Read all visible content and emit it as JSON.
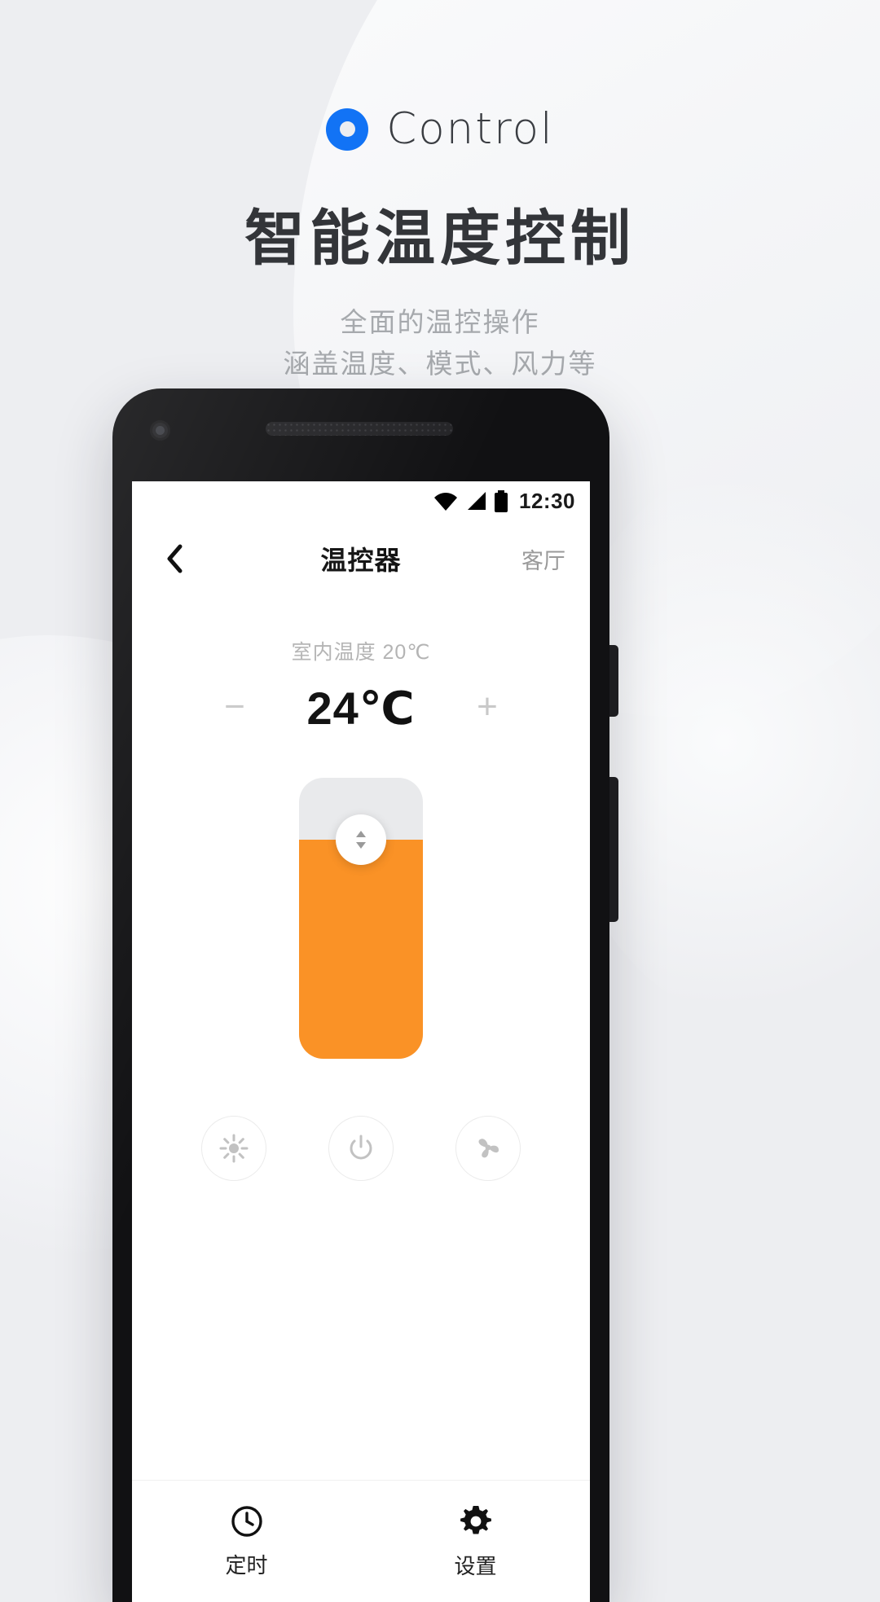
{
  "brand": {
    "name": "Control",
    "mark_icon": "ring-logo-icon",
    "accent": "#1273f5"
  },
  "hero": {
    "headline": "智能温度控制",
    "subtitle_line1": "全面的温控操作",
    "subtitle_line2": "涵盖温度、模式、风力等"
  },
  "phone": {
    "statusbar": {
      "wifi_icon": "wifi-icon",
      "signal_icon": "cellular-signal-icon",
      "battery_icon": "battery-full-icon",
      "clock": "12:30"
    },
    "appbar": {
      "back_icon": "chevron-left-icon",
      "title": "温控器",
      "room": "客厅"
    },
    "thermostat": {
      "room_temperature": "室内温度 20℃",
      "decrease_label": "−",
      "setpoint": "24℃",
      "increase_label": "+",
      "slider": {
        "fill_percent": 78,
        "fill_color": "#fa9226",
        "track_color": "#e9eaec",
        "knob_icon": "updown-arrows-icon"
      },
      "controls": [
        {
          "name": "mode-button",
          "icon": "sun-mode-icon"
        },
        {
          "name": "power-button",
          "icon": "power-icon"
        },
        {
          "name": "fan-button",
          "icon": "fan-icon"
        }
      ]
    },
    "tabbar": [
      {
        "name": "tab-timer",
        "icon": "clock-icon",
        "label": "定时"
      },
      {
        "name": "tab-settings",
        "icon": "gear-icon",
        "label": "设置"
      }
    ]
  }
}
